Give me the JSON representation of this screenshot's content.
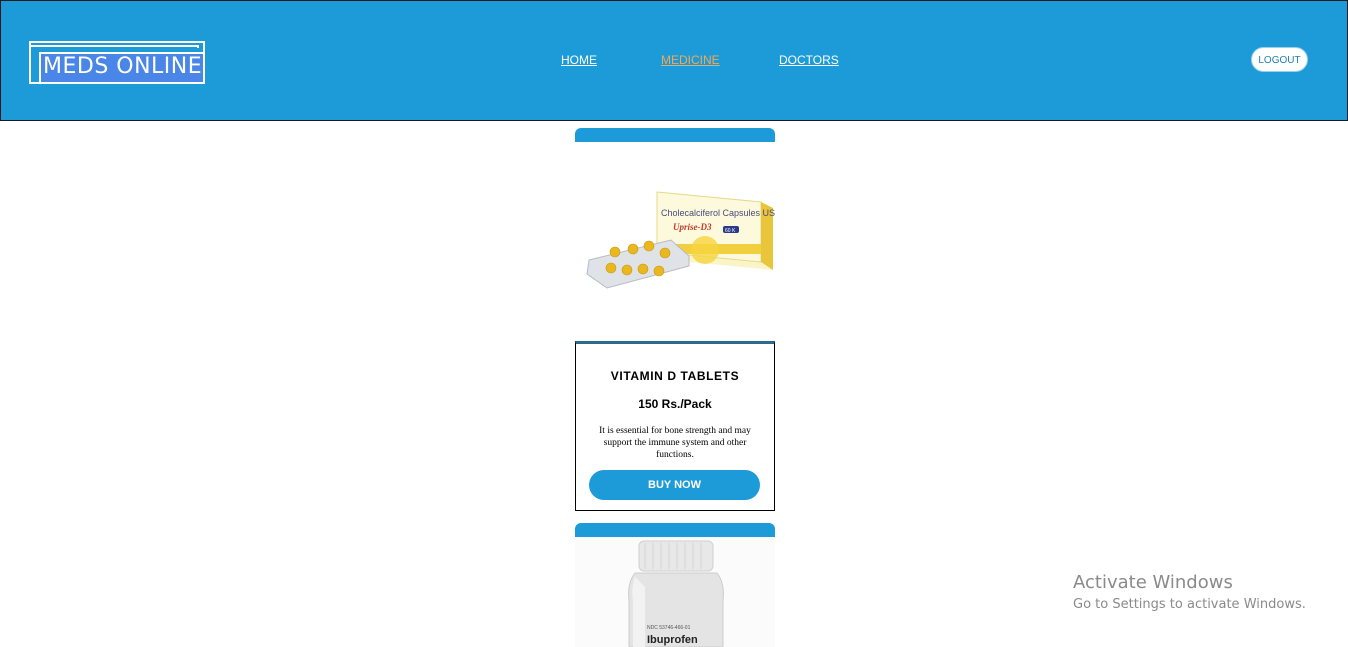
{
  "header": {
    "logo_text": "MEDS ONLINE",
    "nav": [
      {
        "label": "HOME",
        "active": false
      },
      {
        "label": "MEDICINE",
        "active": true
      },
      {
        "label": "DOCTORS",
        "active": false
      }
    ],
    "logout_label": "LOGOUT"
  },
  "colors": {
    "header_bg": "#1d9bd8",
    "accent": "#1d9bd8",
    "nav_active": "#f0a95a",
    "logo_bg": "#4a86e8"
  },
  "products": [
    {
      "image_icon": "vitamin-d-capsules-pack-image",
      "image_text": "Cholecalciferol Capsules USP",
      "image_brand": "Uprise-D3",
      "image_badge": "60 K",
      "title": "VITAMIN D TABLETS",
      "price": "150 Rs./Pack",
      "description": "It is essential for bone strength and may support the immune system and other functions.",
      "buy_label": "BUY NOW"
    },
    {
      "image_icon": "ibuprofen-bottle-image",
      "image_label": "Ibuprofen",
      "image_code": "NDC 53746-466-01"
    }
  ],
  "watermark": {
    "title": "Activate Windows",
    "subtitle": "Go to Settings to activate Windows."
  }
}
